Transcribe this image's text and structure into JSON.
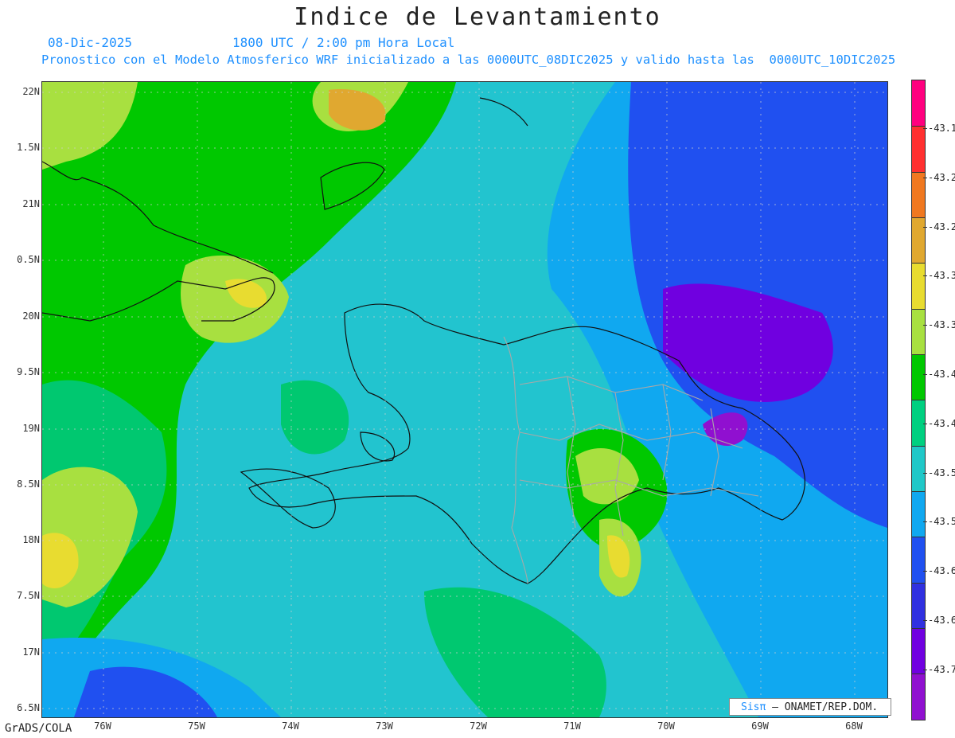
{
  "title": "Indice de Levantamiento",
  "date": "08-Dic-2025",
  "time": "1800 UTC / 2:00 pm Hora Local",
  "info": "Pronostico con el Modelo Atmosferico WRF inicializado a las 0000UTC_08DIC2025 y valido hasta las  0000UTC_10DIC2025",
  "footer": "GrADS/COLA",
  "credit": {
    "brand": "Sisπ",
    "text": "– ONAMET/REP.DOM."
  },
  "lat_labels": [
    "22N",
    "1.5N",
    "21N",
    "0.5N",
    "20N",
    "9.5N",
    "19N",
    "8.5N",
    "18N",
    "7.5N",
    "17N",
    "6.5N"
  ],
  "lon_labels": [
    "76W",
    "75W",
    "74W",
    "73W",
    "72W",
    "71W",
    "70W",
    "69W",
    "68W"
  ],
  "colorbar": {
    "colors": [
      "#ff007f",
      "#ff3030",
      "#f07820",
      "#e0a830",
      "#e8dc30",
      "#a8e040",
      "#00c800",
      "#00d080",
      "#20c8c8",
      "#10a8f0",
      "#2050f0",
      "#3030e0",
      "#7000e0",
      "#9010d0"
    ],
    "labels": [
      "-43.1",
      "-43.2",
      "-43.2",
      "-43.3",
      "-43.3",
      "-43.4",
      "-43.4",
      "-43.5",
      "-43.5",
      "-43.6",
      "-43.6",
      "-43.7"
    ]
  }
}
